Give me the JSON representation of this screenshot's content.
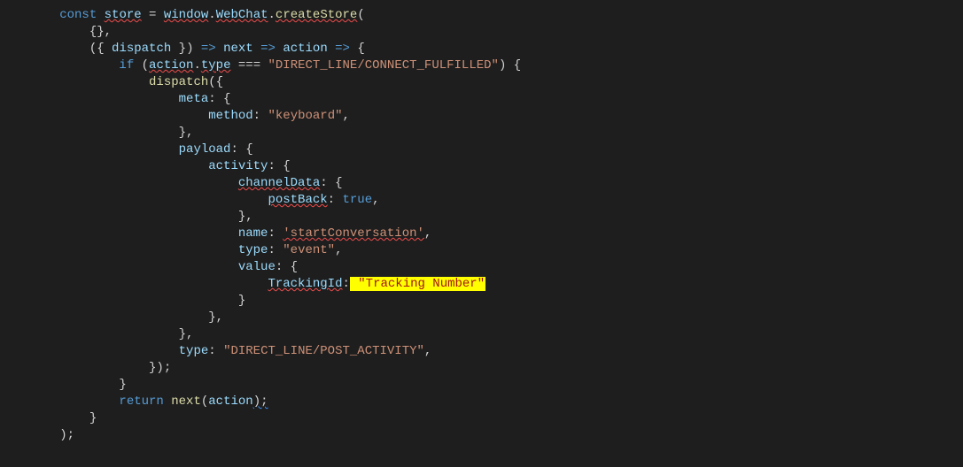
{
  "code": {
    "kw_const": "const",
    "var_store": "store",
    "eq": " = ",
    "var_window": "window",
    "dot1": ".",
    "var_WebChat": "WebChat",
    "dot2": ".",
    "fn_createStore": "createStore",
    "paren_open": "(",
    "l2_braces": "{},",
    "l3_open_dispatch": "({ ",
    "var_dispatch": "dispatch",
    "l3_close_dispatch": " }) ",
    "arrow1": "=>",
    "sp1": " ",
    "var_next": "next",
    "sp2": " ",
    "arrow2": "=>",
    "sp3": " ",
    "var_action": "action",
    "sp4": " ",
    "arrow3": "=>",
    "sp5": " {",
    "kw_if": "if",
    "l4_if_open": " (",
    "var_action2": "action",
    "dot3": ".",
    "var_type": "type",
    "l4_eqeqeq": " === ",
    "str_connect": "\"DIRECT_LINE/CONNECT_FULFILLED\"",
    "l4_if_close": ") {",
    "fn_dispatch2": "dispatch",
    "l5_open": "({",
    "prop_meta": "meta",
    "colon_brace": ": {",
    "prop_method": "method",
    "colon_sp": ": ",
    "str_keyboard": "\"keyboard\"",
    "comma": ",",
    "close_brace_comma": "},",
    "prop_payload": "payload",
    "prop_activity": "activity",
    "prop_channelData": "channelData",
    "prop_postBack": "postBack",
    "kw_true": "true",
    "prop_name": "name",
    "str_startConv": "'startConversation'",
    "prop_type": "type",
    "str_event": "\"event\"",
    "prop_value": "value",
    "prop_TrackingId": "TrackingId",
    "hl_open": " ",
    "str_tracking": "\"Tracking Number\"",
    "close_brace": "}",
    "prop_type2": "type",
    "str_post_activity": "\"DIRECT_LINE/POST_ACTIVITY\"",
    "l_dispatch_close": "});",
    "kw_return": "return",
    "sp6": " ",
    "fn_next2": "next",
    "paren_open2": "(",
    "var_action3": "action",
    "paren_close_semi": ");",
    "close_paren_semi": ");"
  }
}
